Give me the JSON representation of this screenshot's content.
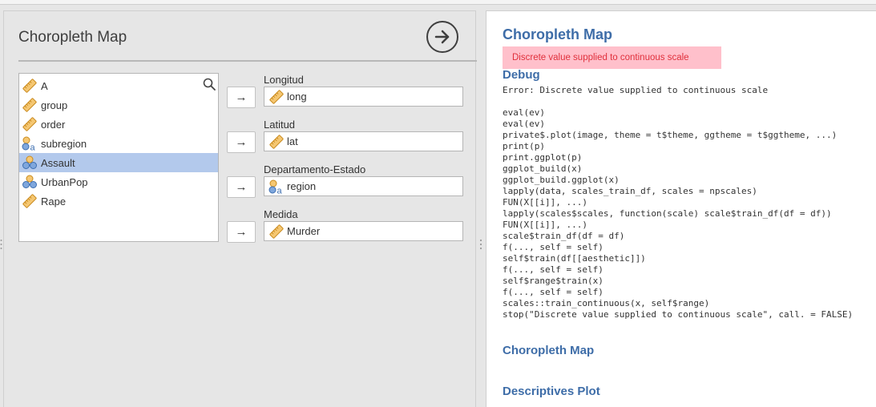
{
  "left": {
    "title": "Choropleth Map",
    "variables": [
      {
        "label": "A",
        "icon": "ruler-icon",
        "selected": false
      },
      {
        "label": "group",
        "icon": "ruler-icon",
        "selected": false
      },
      {
        "label": "order",
        "icon": "ruler-icon",
        "selected": false
      },
      {
        "label": "subregion",
        "icon": "nominal-text-icon",
        "selected": false
      },
      {
        "label": "Assault",
        "icon": "nominal-icon",
        "selected": true
      },
      {
        "label": "UrbanPop",
        "icon": "nominal-icon",
        "selected": false
      },
      {
        "label": "Rape",
        "icon": "ruler-icon",
        "selected": false
      }
    ],
    "targets": [
      {
        "label": "Longitud",
        "value": "long",
        "icon": "ruler-icon"
      },
      {
        "label": "Latitud",
        "value": "lat",
        "icon": "ruler-icon"
      },
      {
        "label": "Departamento-Estado",
        "value": "region",
        "icon": "nominal-text-icon"
      },
      {
        "label": "Medida",
        "value": "Murder",
        "icon": "ruler-icon"
      }
    ],
    "arrow_glyph": "→"
  },
  "results": {
    "title": "Choropleth Map",
    "error": "Discrete value supplied to continuous scale",
    "debug_heading": "Debug",
    "trace": "Error: Discrete value supplied to continuous scale\n\neval(ev)\neval(ev)\nprivate$.plot(image, theme = t$theme, ggtheme = t$ggtheme, ...)\nprint(p)\nprint.ggplot(p)\nggplot_build(x)\nggplot_build.ggplot(x)\nlapply(data, scales_train_df, scales = npscales)\nFUN(X[[i]], ...)\nlapply(scales$scales, function(scale) scale$train_df(df = df))\nFUN(X[[i]], ...)\nscale$train_df(df = df)\nf(..., self = self)\nself$train(df[[aesthetic]])\nf(..., self = self)\nself$range$train(x)\nf(..., self = self)\nscales::train_continuous(x, self$range)\nstop(\"Discrete value supplied to continuous scale\", call. = FALSE)",
    "section_choropleth": "Choropleth Map",
    "section_descriptives": "Descriptives Plot"
  },
  "colors": {
    "accent": "#3e6da8",
    "error_bg": "#ffc0cb",
    "error_text": "#e0303c",
    "selected_row": "#b3c9ec"
  }
}
